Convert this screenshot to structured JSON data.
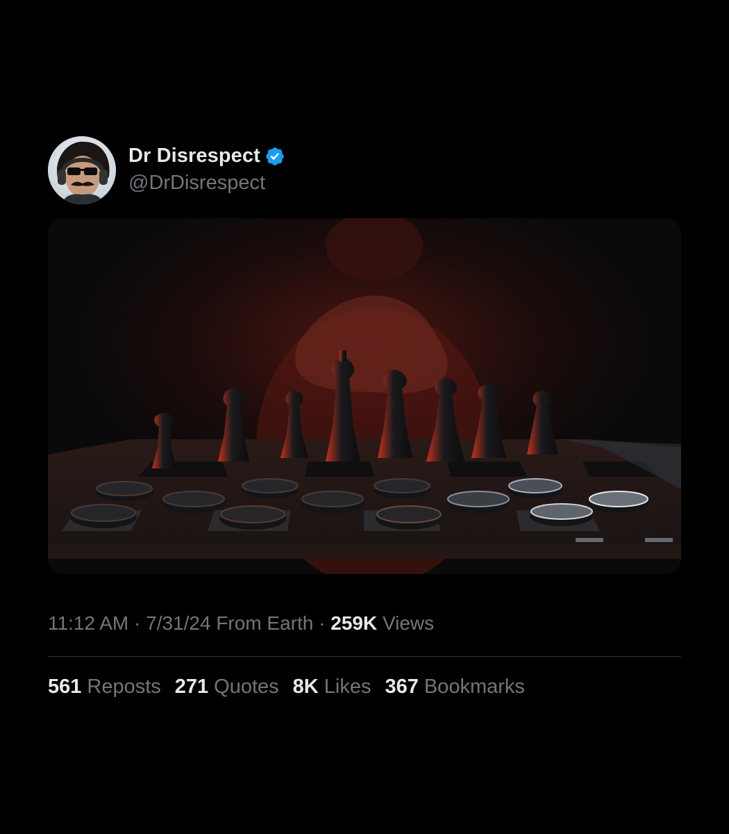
{
  "author": {
    "display_name": "Dr Disrespect",
    "handle": "@DrDisrespect",
    "verified_icon": "verified-badge-icon",
    "avatar_icon": "avatar"
  },
  "media": {
    "icon": "chess-board-photo"
  },
  "meta": {
    "time": "11:12 AM",
    "separator": "·",
    "date": "7/31/24",
    "location": "From Earth",
    "views_count": "259K",
    "views_label": "Views"
  },
  "stats": [
    {
      "count": "561",
      "label": "Reposts"
    },
    {
      "count": "271",
      "label": "Quotes"
    },
    {
      "count": "8K",
      "label": "Likes"
    },
    {
      "count": "367",
      "label": "Bookmarks"
    }
  ],
  "colors": {
    "background": "#000000",
    "primary_text": "#e7e9ea",
    "secondary_text": "#71767b",
    "verified_blue": "#1d9bf0",
    "divider": "#2f3336"
  }
}
